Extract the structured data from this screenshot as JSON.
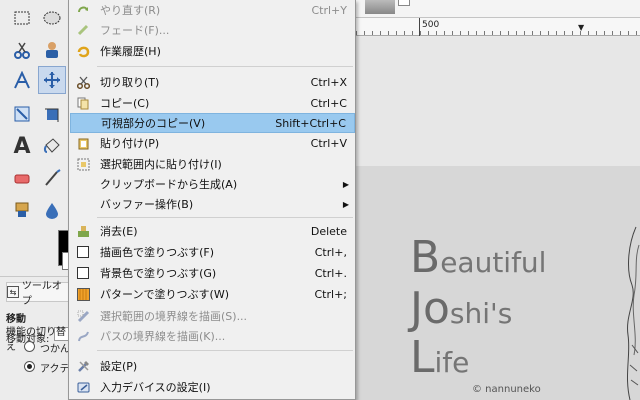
{
  "menu": {
    "items": [
      {
        "label": "やり直す(R)",
        "shortcut": "Ctrl+Y",
        "icon": "redo-icon",
        "disabled": true
      },
      {
        "label": "フェード(F)...",
        "shortcut": "",
        "icon": "fade-icon",
        "disabled": true
      },
      {
        "label": "作業履歴(H)",
        "shortcut": "",
        "icon": "history-icon",
        "disabled": false
      },
      {
        "label": "切り取り(T)",
        "shortcut": "Ctrl+X",
        "icon": "scissors-icon",
        "disabled": false
      },
      {
        "label": "コピー(C)",
        "shortcut": "Ctrl+C",
        "icon": "copy-icon",
        "disabled": false
      },
      {
        "label": "可視部分のコピー(V)",
        "shortcut": "Shift+Ctrl+C",
        "icon": "copy-visible-icon",
        "disabled": false,
        "highlighted": true
      },
      {
        "label": "貼り付け(P)",
        "shortcut": "Ctrl+V",
        "icon": "paste-icon",
        "disabled": false
      },
      {
        "label": "選択範囲内に貼り付け(I)",
        "shortcut": "",
        "icon": "paste-into-icon",
        "disabled": false
      },
      {
        "label": "クリップボードから生成(A)",
        "shortcut": "",
        "icon": "",
        "disabled": false,
        "submenu": true
      },
      {
        "label": "バッファー操作(B)",
        "shortcut": "",
        "icon": "",
        "disabled": false,
        "submenu": true
      },
      {
        "label": "消去(E)",
        "shortcut": "Delete",
        "icon": "clear-icon",
        "disabled": false
      },
      {
        "label": "描画色で塗りつぶす(F)",
        "shortcut": "Ctrl+,",
        "icon": "fg-fill-icon",
        "disabled": false
      },
      {
        "label": "背景色で塗りつぶす(G)",
        "shortcut": "Ctrl+.",
        "icon": "bg-fill-icon",
        "disabled": false
      },
      {
        "label": "パターンで塗りつぶす(W)",
        "shortcut": "Ctrl+;",
        "icon": "pattern-fill-icon",
        "disabled": false
      },
      {
        "label": "選択範囲の境界線を描画(S)...",
        "shortcut": "",
        "icon": "stroke-selection-icon",
        "disabled": true
      },
      {
        "label": "パスの境界線を描画(K)...",
        "shortcut": "",
        "icon": "stroke-path-icon",
        "disabled": true
      },
      {
        "label": "設定(P)",
        "shortcut": "",
        "icon": "preferences-icon",
        "disabled": false
      },
      {
        "label": "入力デバイスの設定(I)",
        "shortcut": "",
        "icon": "input-devices-icon",
        "disabled": false
      }
    ]
  },
  "ruler": {
    "label": "500"
  },
  "tool_options": {
    "tab_label": "ツールオプ",
    "move_title": "移動",
    "move_target_label": "移動対象:",
    "switch_label": "機能の切り替え",
    "radio1": "つかんだ",
    "radio2": "アクティブ"
  },
  "image": {
    "line1_letter": "B",
    "line1_rest": "eautiful",
    "line2_letter": "Jo",
    "line2_rest": "shi's",
    "line3_letter": "L",
    "line3_rest": "ife",
    "copyright": "© nannuneko"
  }
}
